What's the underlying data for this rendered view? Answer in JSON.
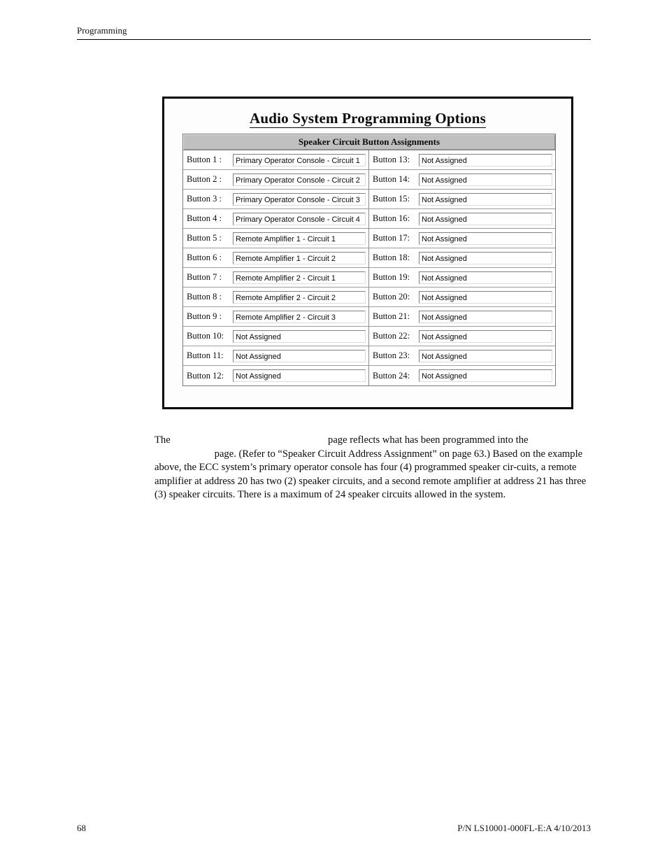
{
  "page": {
    "header_title": "Programming",
    "footer_page_number": "68",
    "footer_part_number": "P/N LS10001-000FL-E:A  4/10/2013"
  },
  "dialog": {
    "title": "Audio System Programming Options",
    "group_header": "Speaker Circuit Button Assignments",
    "rows_left": [
      {
        "label": "Button 1  :",
        "value": "Primary Operator Console - Circuit 1"
      },
      {
        "label": "Button 2  :",
        "value": "Primary Operator Console - Circuit 2"
      },
      {
        "label": "Button 3  :",
        "value": "Primary Operator Console - Circuit 3"
      },
      {
        "label": "Button 4  :",
        "value": "Primary Operator Console - Circuit 4"
      },
      {
        "label": "Button 5  :",
        "value": "Remote Amplifier 1 - Circuit 1"
      },
      {
        "label": "Button 6  :",
        "value": "Remote Amplifier 1 - Circuit 2"
      },
      {
        "label": "Button 7  :",
        "value": "Remote Amplifier 2 - Circuit 1"
      },
      {
        "label": "Button 8  :",
        "value": "Remote Amplifier 2 - Circuit 2"
      },
      {
        "label": "Button 9  :",
        "value": "Remote Amplifier 2 - Circuit 3"
      },
      {
        "label": "Button 10:",
        "value": "Not Assigned"
      },
      {
        "label": "Button 11:",
        "value": "Not Assigned"
      },
      {
        "label": "Button 12:",
        "value": "Not Assigned"
      }
    ],
    "rows_right": [
      {
        "label": "Button 13:",
        "value": "Not Assigned"
      },
      {
        "label": "Button 14:",
        "value": "Not Assigned"
      },
      {
        "label": "Button 15:",
        "value": "Not Assigned"
      },
      {
        "label": "Button 16:",
        "value": "Not Assigned"
      },
      {
        "label": "Button 17:",
        "value": "Not Assigned"
      },
      {
        "label": "Button 18:",
        "value": "Not Assigned"
      },
      {
        "label": "Button 19:",
        "value": "Not Assigned"
      },
      {
        "label": "Button 20:",
        "value": "Not Assigned"
      },
      {
        "label": "Button 21:",
        "value": "Not Assigned"
      },
      {
        "label": "Button 22:",
        "value": "Not Assigned"
      },
      {
        "label": "Button 23:",
        "value": "Not Assigned"
      },
      {
        "label": "Button 24:",
        "value": "Not Assigned"
      }
    ],
    "colors": {
      "group_header_bg": "#c0c0c0",
      "field_bg": "#ffffff",
      "frame_border": "#000000"
    }
  },
  "body_text": {
    "seg_1": "The",
    "seg_blank_1": "",
    "seg_2": "page reflects what has been programmed into the",
    "seg_blank_2": "",
    "seg_3": "page.  (Refer to “Speaker Circuit Address Assignment” on page 63.)  Based on the example above, the ECC system’s primary operator console has four (4) programmed speaker cir-cuits, a remote amplifier at address 20 has two (2) speaker circuits, and a second remote amplifier at address 21 has three (3) speaker circuits.  There is a maximum of 24 speaker circuits allowed in the system."
  }
}
